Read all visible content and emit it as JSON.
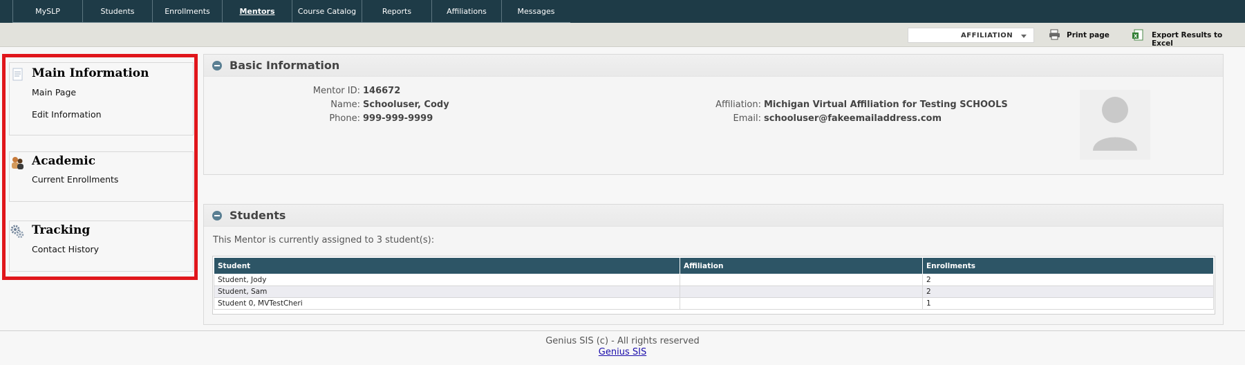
{
  "nav": {
    "items": [
      {
        "label": "MySLP",
        "active": false
      },
      {
        "label": "Students",
        "active": false
      },
      {
        "label": "Enrollments",
        "active": false
      },
      {
        "label": "Mentors",
        "active": true
      },
      {
        "label": "Course Catalog",
        "active": false
      },
      {
        "label": "Reports",
        "active": false
      },
      {
        "label": "Affiliations",
        "active": false
      },
      {
        "label": "Messages",
        "active": false
      }
    ]
  },
  "toolbar": {
    "filter_value": "AFFILIATION",
    "print_label": "Print page",
    "export_label": "Export Results to Excel"
  },
  "sidebar": {
    "main": {
      "heading": "Main Information",
      "links": [
        "Main Page",
        "Edit Information"
      ],
      "icon": "document-icon"
    },
    "academic": {
      "heading": "Academic",
      "links": [
        "Current Enrollments"
      ],
      "icon": "people-icon"
    },
    "tracking": {
      "heading": "Tracking",
      "links": [
        "Contact History"
      ],
      "icon": "gears-icon"
    }
  },
  "basic": {
    "title": "Basic Information",
    "mentor_id_label": "Mentor ID:",
    "mentor_id": "146672",
    "name_label": "Name:",
    "name": "Schooluser, Cody",
    "phone_label": "Phone:",
    "phone": "999-999-9999",
    "affiliation_label": "Affiliation:",
    "affiliation": "Michigan Virtual Affiliation for Testing SCHOOLS",
    "email_label": "Email:",
    "email": "schooluser@fakeemailaddress.com"
  },
  "students": {
    "title": "Students",
    "assigned_text": "This Mentor is currently assigned to 3 student(s):",
    "columns": [
      "Student",
      "Affiliation",
      "Enrollments"
    ],
    "rows": [
      [
        "Student, Jody",
        "",
        "2"
      ],
      [
        "Student, Sam",
        "",
        "2"
      ],
      [
        "Student 0, MVTestCheri",
        "",
        "1"
      ]
    ]
  },
  "footer": {
    "copyright": "Genius SIS (c) - All rights reserved",
    "link": "Genius SIS"
  },
  "colors": {
    "nav_bg": "#1e3b47",
    "table_header": "#2d5566",
    "highlight_frame": "#e0161b"
  }
}
